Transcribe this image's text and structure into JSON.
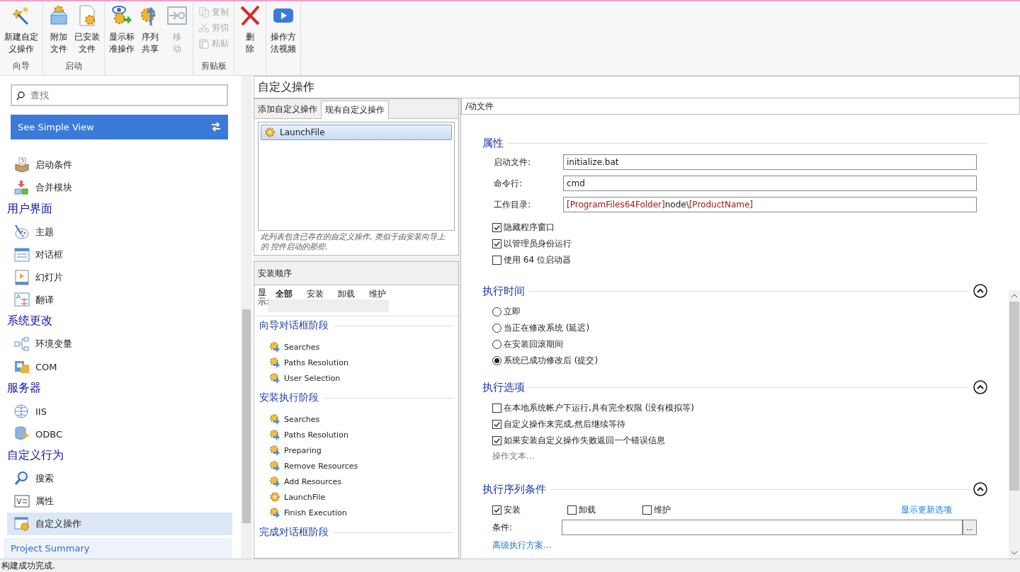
{
  "toolbar": {
    "groups": [
      {
        "label": "向导",
        "buttons": [
          {
            "kind": "wand",
            "label": "新建自定义操作",
            "disabled": false
          }
        ]
      },
      {
        "label": "启动",
        "buttons": [
          {
            "kind": "gear-box",
            "label": "附加文件",
            "disabled": false
          },
          {
            "kind": "gear-file",
            "label": "已安装文件",
            "disabled": false
          }
        ]
      },
      {
        "buttons": [
          {
            "kind": "eye-gear",
            "label": "显示标准操作",
            "disabled": false
          },
          {
            "kind": "gear-arrow",
            "label": "序列共享",
            "disabled": false
          },
          {
            "kind": "move",
            "label": "移动",
            "disabled": true
          }
        ]
      },
      {
        "label": "剪贴板",
        "small": [
          {
            "kind": "copy",
            "label": "复制",
            "disabled": true
          },
          {
            "kind": "cut",
            "label": "剪切",
            "disabled": true
          },
          {
            "kind": "paste",
            "label": "粘贴",
            "disabled": true
          }
        ]
      },
      {
        "buttons": [
          {
            "kind": "delete",
            "label": "删除",
            "disabled": false
          }
        ]
      },
      {
        "buttons": [
          {
            "kind": "video",
            "label": "操作方法视频",
            "disabled": false
          }
        ]
      }
    ]
  },
  "sidebar": {
    "search": {
      "placeholder": "查找"
    },
    "view_button": "See Simple View",
    "sections": [
      {
        "items": [
          {
            "label": "启动条件",
            "selected": false
          },
          {
            "label": "合并模块",
            "selected": false
          }
        ]
      },
      {
        "title": "用户界面",
        "items": [
          {
            "label": "主题",
            "selected": false
          },
          {
            "label": "对话框",
            "selected": false
          },
          {
            "label": "幻灯片",
            "selected": false
          },
          {
            "label": "翻译",
            "selected": false
          }
        ]
      },
      {
        "title": "系统更改",
        "items": [
          {
            "label": "环境变量",
            "selected": false
          },
          {
            "label": "COM",
            "selected": false
          }
        ]
      },
      {
        "title": "服务器",
        "items": [
          {
            "label": "IIS",
            "selected": false
          },
          {
            "label": "ODBC",
            "selected": false
          }
        ]
      },
      {
        "title": "自定义行为",
        "items": [
          {
            "label": "搜索",
            "selected": false
          },
          {
            "label": "属性",
            "selected": false
          },
          {
            "label": "自定义操作",
            "selected": true
          }
        ]
      }
    ],
    "footer_link": "Project Summary"
  },
  "page_title": "自定义操作",
  "tabs": [
    {
      "label": "添加自定义操作",
      "selected": false
    },
    {
      "label": "现有自定义操作",
      "selected": true
    }
  ],
  "actions": [
    {
      "label": "LaunchFile",
      "selected": true
    }
  ],
  "note": "此列表包含已存在的自定义操作, 类似于由安装向导上的 控件启动的那些.",
  "sequence": {
    "title": "安装顺序",
    "filter_label": "显示:",
    "filters": [
      {
        "label": "全部",
        "selected": true
      },
      {
        "label": "安装",
        "selected": false
      },
      {
        "label": "卸载",
        "selected": false
      },
      {
        "label": "维护",
        "selected": false
      }
    ],
    "phases": [
      {
        "title": "向导对话框阶段",
        "steps": [
          {
            "kind": "standard",
            "label": "Searches"
          },
          {
            "kind": "standard",
            "label": "Paths Resolution"
          },
          {
            "kind": "standard",
            "label": "User Selection"
          }
        ]
      },
      {
        "title": "安装执行阶段",
        "steps": [
          {
            "kind": "standard",
            "label": "Searches"
          },
          {
            "kind": "standard",
            "label": "Paths Resolution"
          },
          {
            "kind": "standard",
            "label": "Preparing"
          },
          {
            "kind": "standard",
            "label": "Remove Resources"
          },
          {
            "kind": "standard",
            "label": "Add Resources"
          },
          {
            "kind": "custom",
            "label": "LaunchFile"
          },
          {
            "kind": "standard",
            "label": "Finish Execution"
          }
        ]
      },
      {
        "title": "完成对话框阶段"
      }
    ]
  },
  "details": {
    "path": "/动文件",
    "properties": {
      "title": "属性",
      "fields": [
        {
          "label": "启动文件:",
          "value": [
            {
              "kind": "plain",
              "text": "initialize.bat"
            }
          ]
        },
        {
          "label": "命令行:",
          "value": [
            {
              "kind": "plain",
              "text": "cmd"
            }
          ]
        },
        {
          "label": "工作目录:",
          "value": [
            {
              "kind": "property",
              "text": "[ProgramFiles64Folder]"
            },
            {
              "kind": "plain",
              "text": "node\\"
            },
            {
              "kind": "property",
              "text": "[ProductName]"
            }
          ]
        }
      ],
      "options": [
        {
          "label": "隐藏程序窗口",
          "checked": true
        },
        {
          "label": "以管理员身份运行",
          "checked": true
        },
        {
          "label": "使用 64 位启动器",
          "checked": false
        }
      ]
    },
    "timing": {
      "title": "执行时间",
      "choices": [
        {
          "label": "立即",
          "selected": false
        },
        {
          "label": "当正在修改系统 (延迟)",
          "selected": false
        },
        {
          "label": "在安装回滚期间",
          "selected": false
        },
        {
          "label": "系统已成功修改后 (提交)",
          "selected": true
        }
      ]
    },
    "execution": {
      "title": "执行选项",
      "options": [
        {
          "label": "在本地系统帐户下运行,具有完全权限 (没有模拟等)",
          "checked": false
        },
        {
          "label": "自定义操作来完成,然后继续等待",
          "checked": true
        },
        {
          "label": "如果安装自定义操作失败返回一个错误信息",
          "checked": true
        }
      ],
      "action_text": "操作文本..."
    },
    "conditions": {
      "title": "执行序列条件",
      "options": [
        {
          "label": "安装",
          "checked": true
        },
        {
          "label": "卸载",
          "checked": false
        },
        {
          "label": "维护",
          "checked": false
        }
      ],
      "update_link": "显示更新选项",
      "condition_label": "条件:",
      "browse": "...",
      "advanced_link": "高级执行方案..."
    }
  },
  "status_bar": "构建成功完成."
}
